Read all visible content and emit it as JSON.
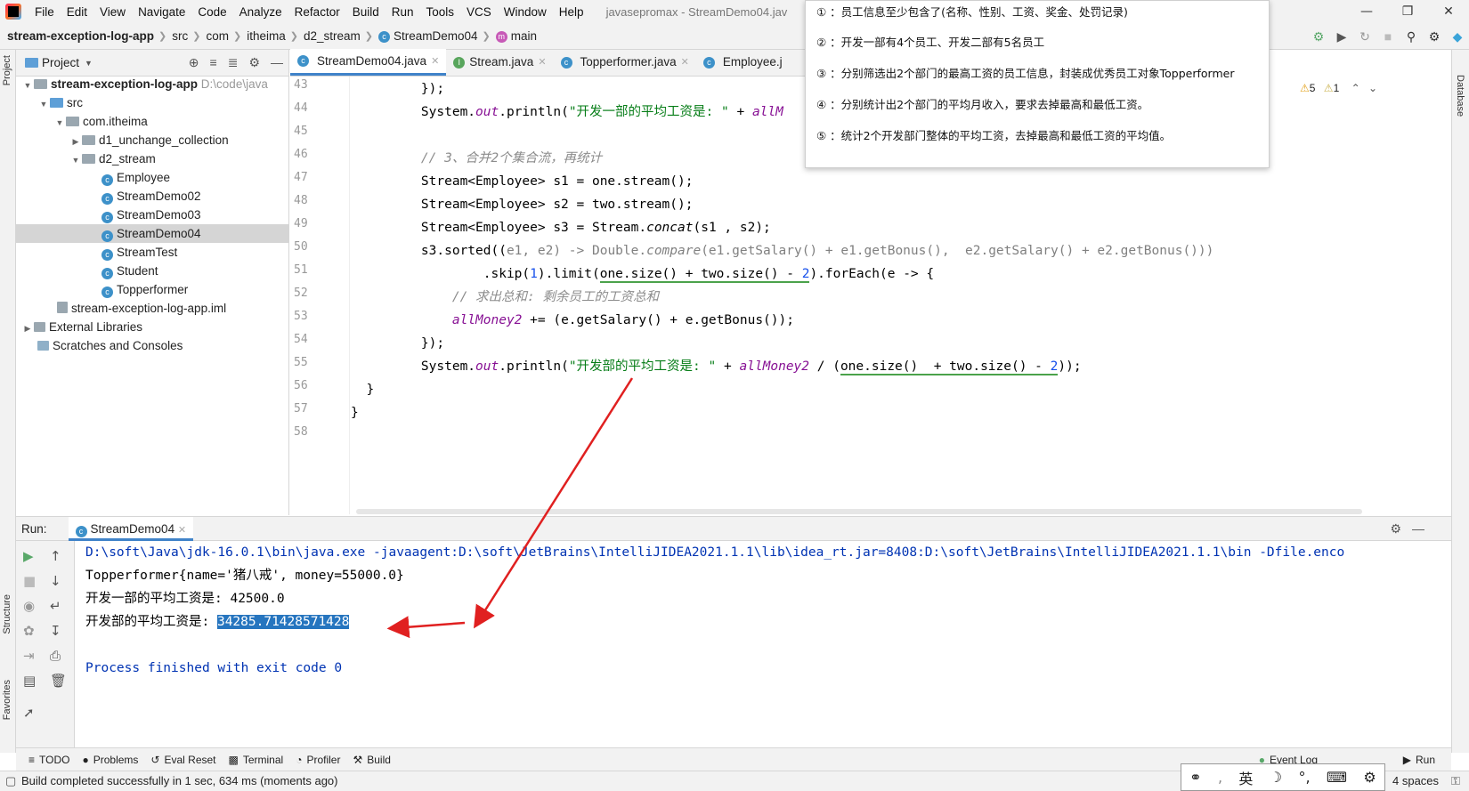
{
  "menubar": {
    "items": [
      "File",
      "Edit",
      "View",
      "Navigate",
      "Code",
      "Analyze",
      "Refactor",
      "Build",
      "Run",
      "Tools",
      "VCS",
      "Window",
      "Help"
    ],
    "window_title": "javasepromax - StreamDemo04.jav"
  },
  "navbar": {
    "project": "stream-exception-log-app",
    "crumbs": [
      "src",
      "com",
      "itheima",
      "d2_stream",
      "StreamDemo04",
      "main"
    ]
  },
  "project_panel": {
    "title": "Project",
    "root_name": "stream-exception-log-app",
    "root_path": "D:\\code\\java",
    "tree": [
      "src",
      "com.itheima",
      "d1_unchange_collection",
      "d2_stream",
      "Employee",
      "StreamDemo02",
      "StreamDemo03",
      "StreamDemo04",
      "StreamTest",
      "Student",
      "Topperformer",
      "stream-exception-log-app.iml",
      "External Libraries",
      "Scratches and Consoles"
    ]
  },
  "editor_tabs": [
    "StreamDemo04.java",
    "Stream.java",
    "Topperformer.java",
    "Employee.j"
  ],
  "line_numbers": [
    "43",
    "44",
    "45",
    "46",
    "47",
    "48",
    "49",
    "50",
    "51",
    "52",
    "53",
    "54",
    "55",
    "56",
    "57",
    "58"
  ],
  "code": {
    "l43": "    });",
    "l44a": "    System.",
    "l44b": "out",
    "l44c": ".println(",
    "l44d": "\"开发一部的平均工资是: \"",
    "l44e": " + ",
    "l44f": "allM",
    "l46": "    // 3、合并2个集合流，再统计",
    "l47": "    Stream<Employee> s1 = one.stream();",
    "l48": "    Stream<Employee> s2 = two.stream();",
    "l49a": "    Stream<Employee> s3 = Stream.",
    "l49b": "concat",
    "l49c": "(s1 , s2);",
    "l50a": "    s3.sorted((",
    "l50b": "e1, e2) -> Double.",
    "l50c": "compare",
    "l50d": "(e1.getSalary() + e1.getBonus(),  e2.getSalary() + e2.getBonus()))",
    "l51a": "            .skip(",
    "l51b": "1",
    "l51c": ").limit(",
    "l51d": "one.size() + two.size() - ",
    "l51e": "2",
    "l51f": ").forEach(e -> {",
    "l52": "        // 求出总和: 剩余员工的工资总和",
    "l53a": "        ",
    "l53b": "allMoney2",
    "l53c": " += (e.getSalary() + e.getBonus());",
    "l54": "    });",
    "l55a": "    System.",
    "l55b": "out",
    "l55c": ".println(",
    "l55d": "\"开发部的平均工资是: \"",
    "l55e": " + ",
    "l55f": "allMoney2",
    "l55g": " / (",
    "l55h": "one.size()  + two.size() - ",
    "l55i": "2",
    "l55j": "));",
    "l56": "  }",
    "l57": "}"
  },
  "popup": {
    "items": [
      "① ：员工信息至少包含了(名称、性别、工资、奖金、处罚记录)",
      "② ：开发一部有4个员工、开发二部有5名员工",
      "③ ：分别筛选出2个部门的最高工资的员工信息，封装成优秀员工对象Topperformer",
      "④ ：分别统计出2个部门的平均月收入，要求去掉最高和最低工资。",
      "⑤ ：统计2个开发部门整体的平均工资，去掉最高和最低工资的平均值。"
    ]
  },
  "inspections": {
    "warnings": "5",
    "weak": "1"
  },
  "run": {
    "label": "Run:",
    "tab": "StreamDemo04",
    "cmd": "D:\\soft\\Java\\jdk-16.0.1\\bin\\java.exe -javaagent:D:\\soft\\JetBrains\\IntelliJIDEA2021.1.1\\lib\\idea_rt.jar=8408:D:\\soft\\JetBrains\\IntelliJIDEA2021.1.1\\bin -Dfile.enco",
    "out1": "Topperformer{name='猪八戒', money=55000.0}",
    "out2": "开发一部的平均工资是: 42500.0",
    "out3_prefix": "开发部的平均工资是: ",
    "out3_value": "34285.71428571428",
    "exit": "Process finished with exit code 0"
  },
  "toolwindows": [
    "TODO",
    "Problems",
    "Eval Reset",
    "Terminal",
    "Profiler",
    "Build"
  ],
  "side_labels": {
    "project": "Project",
    "structure": "Structure",
    "favorites": "Favorites",
    "database": "Database"
  },
  "event_log": "Event Log",
  "run_button": "Run",
  "status": {
    "message": "Build completed successfully in 1 sec, 634 ms (moments ago)",
    "indent": "4 spaces",
    "ime_lang": "英"
  },
  "colors": {
    "accent": "#4083c9",
    "arrow": "#e02020",
    "selection": "#2675bf"
  }
}
